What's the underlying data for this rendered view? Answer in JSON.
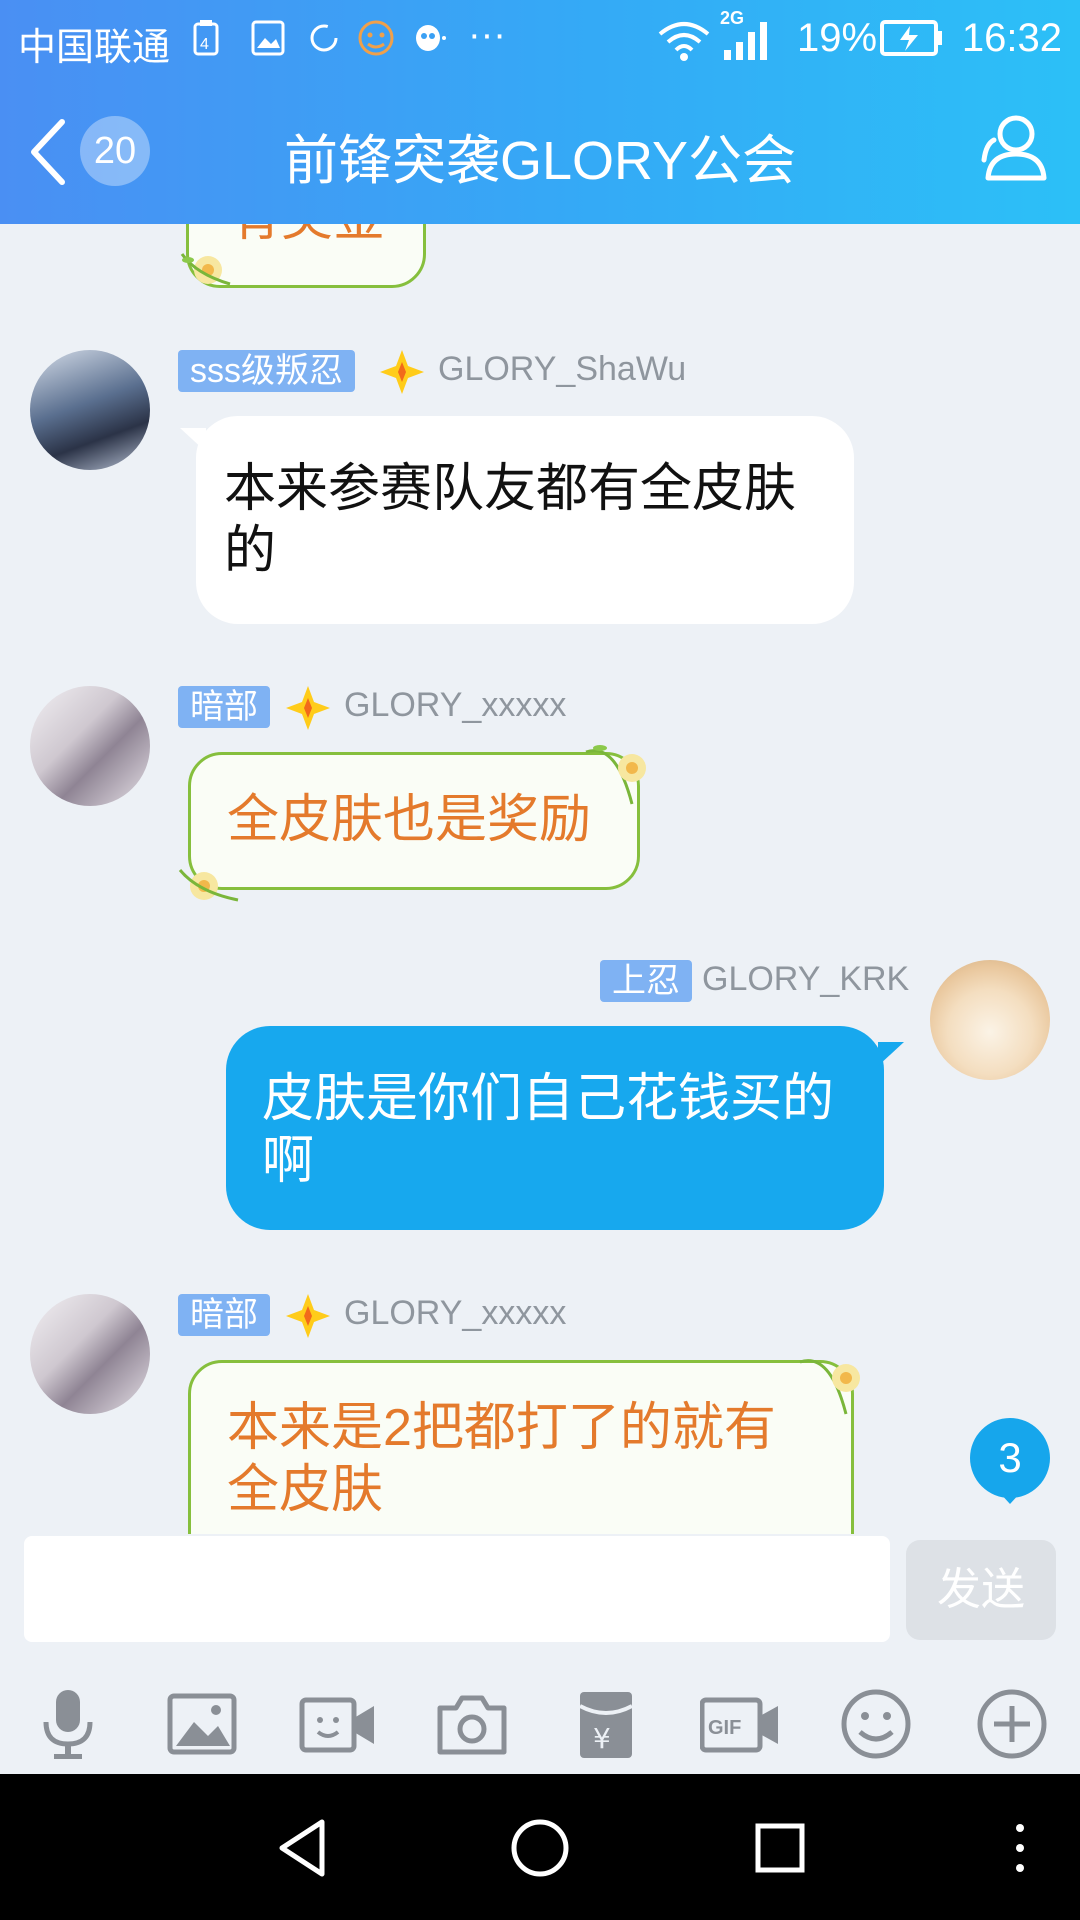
{
  "status_bar": {
    "carrier": "中国联通",
    "network": "2G",
    "battery": "19%",
    "time": "16:32",
    "icons": [
      "sim-alert-icon",
      "image-icon",
      "sync-icon",
      "emoji-notify-icon",
      "qq-icon",
      "more-dots-icon",
      "wifi-icon",
      "signal-icon",
      "battery-charging-icon"
    ],
    "more": "···"
  },
  "header": {
    "title": "前锋突袭GLORY公会",
    "unread_count": "20",
    "icons": [
      "back-chevron-icon",
      "group-members-icon"
    ]
  },
  "messages": [
    {
      "side": "left",
      "badge": "",
      "name": "",
      "text": "有奖金",
      "style": "green"
    },
    {
      "side": "left",
      "badge": "sss级叛忍",
      "name": "GLORY_ShaWu",
      "text": "本来参赛队友都有全皮肤的",
      "style": "white"
    },
    {
      "side": "left",
      "badge": "暗部",
      "name": "GLORY_xxxxx",
      "text": "全皮肤也是奖励",
      "style": "green"
    },
    {
      "side": "right",
      "badge": "上忍",
      "name": "GLORY_KRK",
      "text": "皮肤是你们自己花钱买的啊",
      "style": "blue"
    },
    {
      "side": "left",
      "badge": "暗部",
      "name": "GLORY_xxxxx",
      "text": "本来是2把都打了的就有全皮肤",
      "style": "green"
    }
  ],
  "new_message_count": "3",
  "input": {
    "placeholder": "",
    "send_label": "发送"
  },
  "toolbar": [
    "microphone-icon",
    "image-icon",
    "video-call-icon",
    "camera-icon",
    "red-packet-icon",
    "gif-icon",
    "emoji-icon",
    "plus-icon"
  ],
  "nav": [
    "back-triangle-icon",
    "home-circle-icon",
    "recents-square-icon",
    "menu-dots-icon"
  ],
  "colors": {
    "header_start": "#4a8ff3",
    "header_end": "#2cc0f7",
    "badge": "#7fb2f3",
    "outgoing": "#17a8ee",
    "special_text": "#e47a2c",
    "special_border": "#86bf3d"
  }
}
